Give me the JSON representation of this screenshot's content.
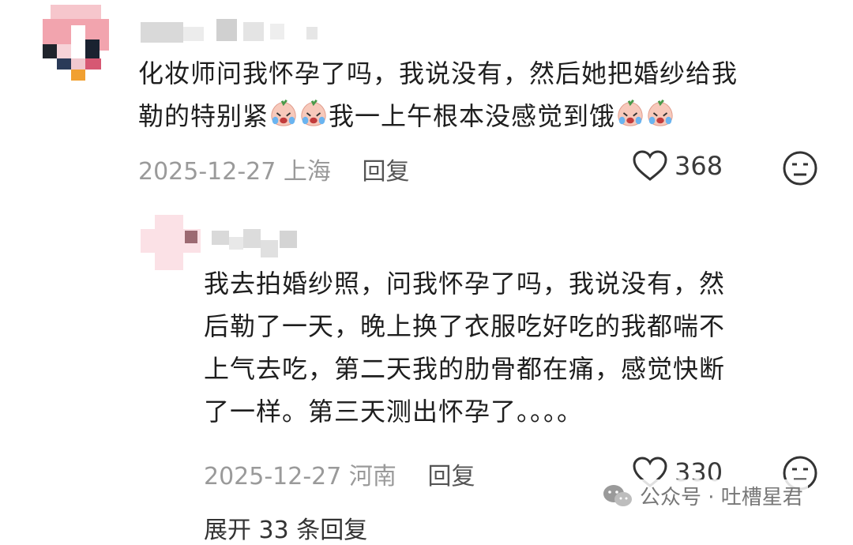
{
  "comments": [
    {
      "text_line1": "化妆师问我怀孕了吗，我说没有，然后她把婚纱给我",
      "text_line2_a": "勒的特别紧",
      "text_line2_b": "我一上午根本没感觉到饿",
      "date": "2025-12-27",
      "location": "上海",
      "reply_label": "回复",
      "likes": "368"
    },
    {
      "text_lines": [
        "我去拍婚纱照，问我怀孕了吗，我说没有，然",
        "后勒了一天，晚上换了衣服吃好吃的我都喘不",
        "上气去吃，第二天我的肋骨都在痛，感觉快断",
        "了一样。第三天测出怀孕了。。。。"
      ],
      "date": "2025-12-27",
      "location": "河南",
      "reply_label": "回复",
      "likes": "330"
    }
  ],
  "expand_replies": "展开 33 条回复",
  "watermark": "公众号 · 吐槽星君",
  "icons": {
    "like": "heart-outline-icon",
    "dislike": "meh-face-icon",
    "emoji": "crying-peach-emoji-icon",
    "watermark": "wechat-icon"
  },
  "colors": {
    "text": "#1e1e1e",
    "meta": "#9a9a9a",
    "avatar_pink": "#f4a5b0"
  }
}
